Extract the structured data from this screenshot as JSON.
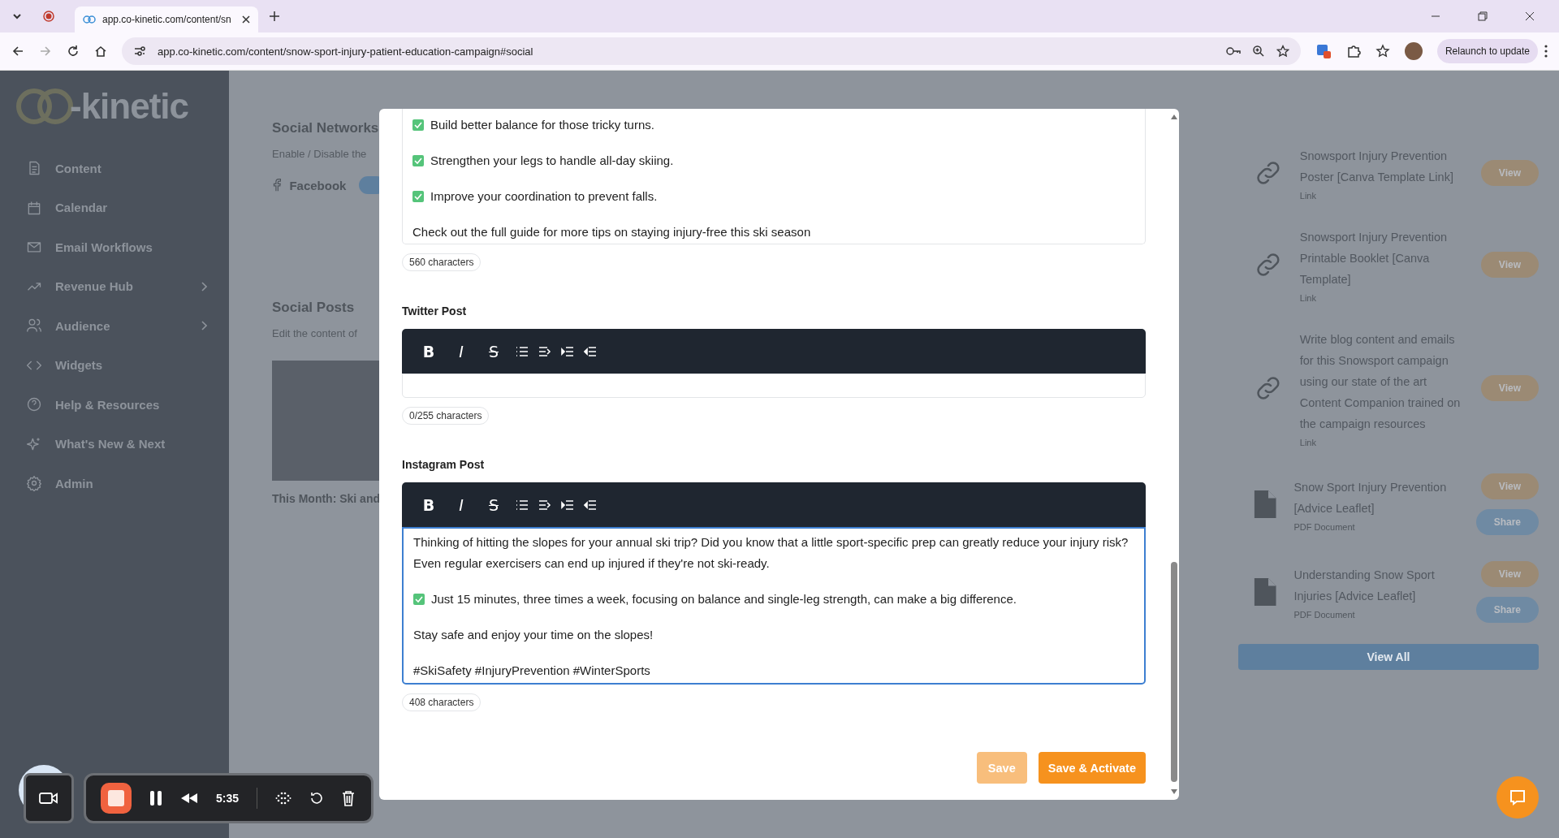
{
  "browser": {
    "tab_title": "app.co-kinetic.com/content/sn",
    "url": "app.co-kinetic.com/content/snow-sport-injury-patient-education-campaign#social",
    "relaunch": "Relaunch to update"
  },
  "sidebar": {
    "logo_text": "-kinetic",
    "items": [
      {
        "label": "Content",
        "submenu": false
      },
      {
        "label": "Calendar",
        "submenu": false
      },
      {
        "label": "Email Workflows",
        "submenu": false
      },
      {
        "label": "Revenue Hub",
        "submenu": true
      },
      {
        "label": "Audience",
        "submenu": true
      },
      {
        "label": "Widgets",
        "submenu": false
      },
      {
        "label": "Help & Resources",
        "submenu": false
      },
      {
        "label": "What's New & Next",
        "submenu": false
      },
      {
        "label": "Admin",
        "submenu": false
      }
    ]
  },
  "page": {
    "social_networks": {
      "title": "Social Networks",
      "subtitle": "Enable / Disable the",
      "network": "Facebook",
      "on": true
    },
    "social_posts": {
      "title": "Social Posts",
      "subtitle": "Edit the content of",
      "caption": "This Month: Ski and"
    }
  },
  "resources": {
    "items": [
      {
        "kind": "link",
        "title": "Snowsport Injury Prevention Poster [Canva Template Link]",
        "type": "Link",
        "buttons": [
          {
            "label": "View",
            "kind": "view"
          }
        ]
      },
      {
        "kind": "link",
        "title": "Snowsport Injury Prevention Printable Booklet [Canva Template]",
        "type": "Link",
        "buttons": [
          {
            "label": "View",
            "kind": "view"
          }
        ]
      },
      {
        "kind": "link",
        "title": "Write blog content and emails for this Snowsport campaign using our state of the art Content Companion trained on the campaign resources",
        "type": "Link",
        "buttons": [
          {
            "label": "View",
            "kind": "view"
          }
        ]
      },
      {
        "kind": "pdf",
        "title": "Snow Sport Injury Prevention [Advice Leaflet]",
        "type": "PDF Document",
        "buttons": [
          {
            "label": "View",
            "kind": "view"
          },
          {
            "label": "Share",
            "kind": "share"
          }
        ]
      },
      {
        "kind": "pdf",
        "title": "Understanding Snow Sport Injuries [Advice Leaflet]",
        "type": "PDF Document",
        "buttons": [
          {
            "label": "View",
            "kind": "view"
          },
          {
            "label": "Share",
            "kind": "share"
          }
        ]
      }
    ],
    "view_all": "View All"
  },
  "modal": {
    "facebook": {
      "lines": [
        {
          "kind": "check",
          "text": "Build better balance for those tricky turns."
        },
        {
          "kind": "check",
          "text": "Strengthen your legs to handle all-day skiing."
        },
        {
          "kind": "check",
          "text": "Improve your coordination to prevent falls."
        },
        {
          "kind": "para",
          "text": "Check out the full guide for more tips on staying injury-free this ski season"
        }
      ],
      "count": "560 characters"
    },
    "twitter": {
      "label": "Twitter Post",
      "toolbar": [
        "B",
        "I",
        "S"
      ],
      "count": "0/255 characters"
    },
    "instagram": {
      "label": "Instagram Post",
      "toolbar": [
        "B",
        "I",
        "S"
      ],
      "focused": true,
      "lines": [
        {
          "kind": "para",
          "text": "Thinking of hitting the slopes for your annual ski trip? Did you know that a little sport-specific prep can greatly reduce your injury risk? Even regular exercisers can end up injured if they're not ski-ready."
        },
        {
          "kind": "check",
          "text": "Just 15 minutes, three times a week, focusing on balance and single-leg strength, can make a big difference."
        },
        {
          "kind": "para",
          "text": "Stay safe and enjoy your time on the slopes!"
        },
        {
          "kind": "para",
          "text": "#SkiSafety #InjuryPrevention #WinterSports"
        }
      ],
      "count": "408 characters"
    },
    "buttons": [
      {
        "label": "Save",
        "kind": "secondary"
      },
      {
        "label": "Save & Activate",
        "kind": "primary"
      }
    ]
  },
  "recorder": {
    "time": "5:35"
  }
}
